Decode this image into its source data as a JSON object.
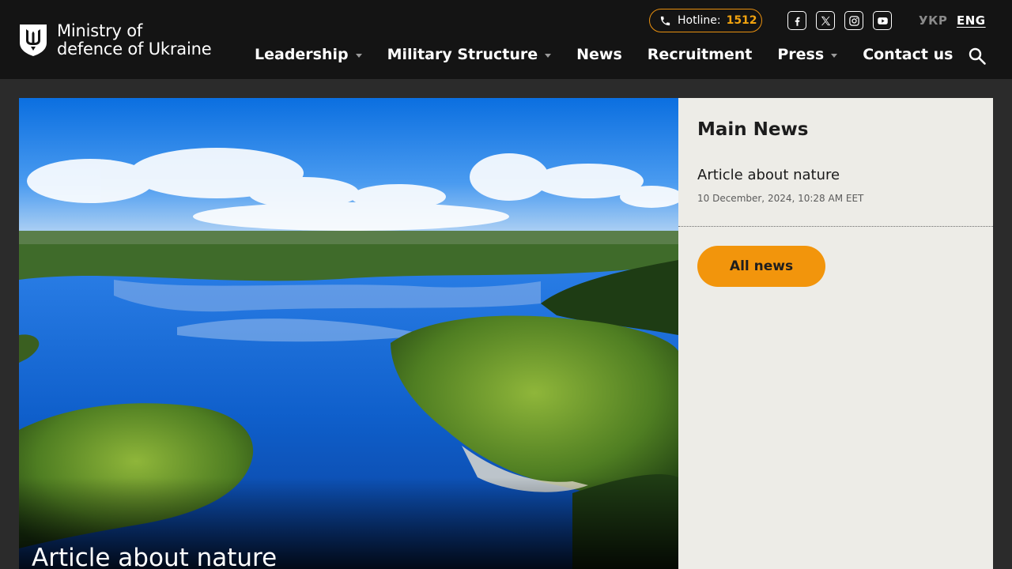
{
  "header": {
    "logo": {
      "line1": "Ministry of",
      "line2": "defence of Ukraine"
    },
    "hotline": {
      "label": "Hotline:",
      "number": "1512"
    },
    "social": [
      {
        "name": "facebook-icon"
      },
      {
        "name": "x-twitter-icon"
      },
      {
        "name": "instagram-icon"
      },
      {
        "name": "youtube-icon"
      }
    ],
    "languages": {
      "ukr": "УКР",
      "eng": "ENG",
      "active": "ENG"
    },
    "nav": [
      {
        "label": "Leadership",
        "has_dropdown": true
      },
      {
        "label": "Military Structure",
        "has_dropdown": true
      },
      {
        "label": "News",
        "has_dropdown": false
      },
      {
        "label": "Recruitment",
        "has_dropdown": false
      },
      {
        "label": "Press",
        "has_dropdown": true
      },
      {
        "label": "Contact us",
        "has_dropdown": false
      }
    ]
  },
  "hero": {
    "title": "Article about nature"
  },
  "sidebar": {
    "heading": "Main News",
    "articles": [
      {
        "title": "Article about nature",
        "date": "10 December, 2024, 10:28 AM EET"
      }
    ],
    "all_news_label": "All news"
  },
  "colors": {
    "header_bg": "#141414",
    "accent": "#f2950c",
    "sidebar_bg": "#edece7",
    "page_bg": "#2b2b2b"
  }
}
